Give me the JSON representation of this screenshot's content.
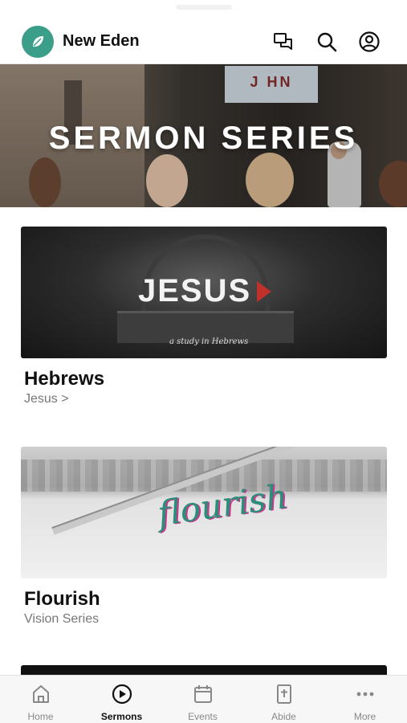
{
  "header": {
    "brand": "New Eden",
    "icons": [
      "chat-icon",
      "search-icon",
      "account-icon"
    ]
  },
  "hero": {
    "title": "SERMON SERIES",
    "screen_text": "J HN"
  },
  "series": [
    {
      "title": "Hebrews",
      "subtitle": "Jesus >",
      "image_text": "JESUS",
      "image_subtext": "a study in Hebrews"
    },
    {
      "title": "Flourish",
      "subtitle": "Vision Series",
      "image_text": "flourish"
    }
  ],
  "tabs": [
    {
      "label": "Home",
      "icon": "home-icon",
      "active": false
    },
    {
      "label": "Sermons",
      "icon": "play-circle-icon",
      "active": true
    },
    {
      "label": "Events",
      "icon": "calendar-icon",
      "active": false
    },
    {
      "label": "Abide",
      "icon": "bible-icon",
      "active": false
    },
    {
      "label": "More",
      "icon": "more-icon",
      "active": false
    }
  ],
  "colors": {
    "brand": "#3a9e89",
    "accent_red": "#c0312b",
    "flourish_green": "#2a8f7a",
    "flourish_pink": "#c43a8a"
  }
}
